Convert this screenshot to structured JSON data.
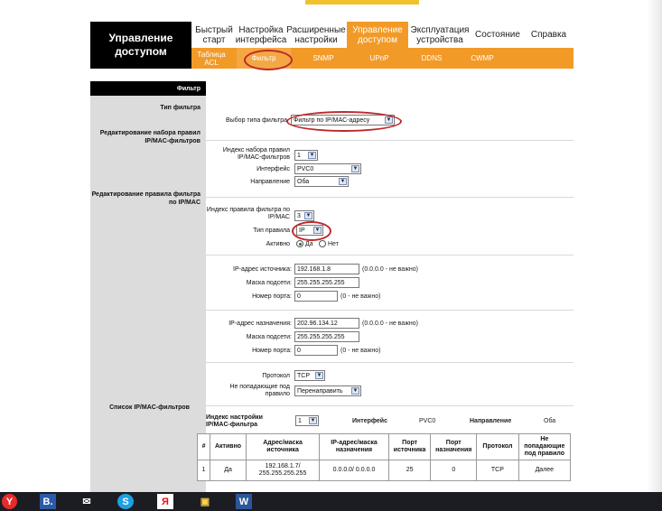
{
  "header": {
    "brand": "Управление доступом",
    "main_tabs": [
      "Быстрый старт",
      "Настройка интерфейса",
      "Расширенные настройки",
      "Управление доступом",
      "Эксплуатация устройства",
      "Состояние",
      "Справка"
    ],
    "sub_tabs": [
      "Таблица ACL",
      "Фильтр",
      "SNMP",
      "UPnP",
      "DDNS",
      "CWMP"
    ]
  },
  "left": {
    "head": "Фильтр",
    "filter_type": "Тип фильтра",
    "edit_set": "Редактирование набора правил IP/MAC-фильтров",
    "edit_rule": "Редактирование правила фильтра по IP/MAC",
    "list": "Список IP/MAC-фильтров"
  },
  "form": {
    "filter_type_label": "Выбор типа фильтра",
    "filter_type_value": "Фильтр по IP/MAC-адресу",
    "set_index_label": "Индекс набора правил IP/MAC-фильтров",
    "set_index_value": "1",
    "interface_label": "Интерфейс",
    "interface_value": "PVC0",
    "direction_label": "Направление",
    "direction_value": "Оба",
    "rule_index_label": "Индекс правила фильтра по IP/MAC",
    "rule_index_value": "3",
    "rule_type_label": "Тип правила",
    "rule_type_value": "IP",
    "active_label": "Активно",
    "yes": "Да",
    "no": "Нет",
    "src_ip_label": "IP-адрес источника",
    "src_ip": "192.168.1.8",
    "src_mask_label": "Маска подсети",
    "src_mask": "255.255.255.255",
    "src_port_label": "Номер порта",
    "src_port": "0",
    "dst_ip_label": "IP-адрес назначения",
    "dst_ip": "202.96.134.12",
    "dst_mask_label": "Маска подсети",
    "dst_mask": "255.255.255.255",
    "dst_port_label": "Номер порта",
    "dst_port": "0",
    "hint_ip": "(0.0.0.0 - не важно)",
    "hint_port": "(0 - не важно)",
    "protocol_label": "Протокол",
    "protocol_value": "TCP",
    "nomatch_label": "Не попадающие под правило",
    "nomatch_value": "Перенаправить"
  },
  "list": {
    "index_label": "Индекс настройки IP/MAC-фильтра",
    "index_value": "1",
    "interface_label": "Интерфейс",
    "interface_value": "PVC0",
    "direction_label": "Направление",
    "direction_value": "Оба",
    "columns": [
      "#",
      "Активно",
      "Адрес/маска источника",
      "IP-адрес/маска назначения",
      "Порт источника",
      "Порт назначения",
      "Протокол",
      "Не попадающие под правило"
    ],
    "rows": [
      [
        "1",
        "Да",
        "192.168.1.7/ 255.255.255.255",
        "0.0.0.0/ 0.0.0.0",
        "25",
        "0",
        "TCP",
        "Далее"
      ]
    ]
  },
  "taskbar": {
    "icons": [
      "yandex-browser-icon",
      "b-app-icon",
      "mail-icon",
      "skype-icon",
      "yandex-icon",
      "store-icon",
      "word-icon"
    ],
    "letters": [
      "Y",
      "B.",
      "✉",
      "S",
      "Я",
      "▣",
      "W"
    ]
  },
  "colors": {
    "accent": "#f29a28",
    "highlight": "#c0282a"
  }
}
